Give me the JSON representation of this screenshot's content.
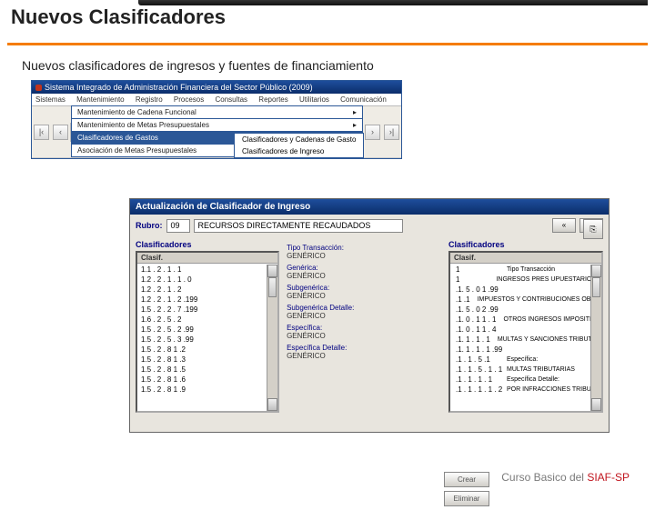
{
  "slide_title": "Nuevos Clasificadores",
  "subtitle": "Nuevos clasificadores de ingresos y fuentes de financiamiento",
  "app": {
    "title": "Sistema Integrado de Administración Financiera del Sector Público (2009)",
    "menu": [
      "Sistemas",
      "Mantenimiento",
      "Registro",
      "Procesos",
      "Consultas",
      "Reportes",
      "Utilitarios",
      "Comunicación"
    ],
    "dropdown": [
      "Mantenimiento de Cadena Funcional",
      "Mantenimiento de Metas Presupuestales",
      "Clasificadores de Gastos",
      "Asociación de Metas Presupuestales"
    ],
    "submenu": [
      "Clasificadores y Cadenas de Gasto",
      "Clasificadores de Ingreso"
    ]
  },
  "dialog": {
    "title": "Actualización de Clasificador de Ingreso",
    "rubro_label": "Rubro:",
    "rubro_code": "09",
    "rubro_desc": "RECURSOS DIRECTAMENTE RECAUDADOS",
    "nav1": "«",
    "nav2": ">",
    "exit": "⎘",
    "left_header": "Clasificadores",
    "left_colhead": "Clasif.",
    "left_items": [
      "1.1 . 2 . 1 . 1",
      "1.2 . 2 . 1 . 1 . 0",
      "1.2 . 2 . 1 . 2",
      "1.2 . 2 . 1 . 2 .199",
      "1.5 . 2 . 2 . 7 .199",
      "1.6 . 2 . 5 . 2",
      "1.5 . 2 . 5 . 2 .99",
      "1.5 . 2 . 5 . 3 .99",
      "1.5 . 2 . 8 1 .2",
      "1.5 . 2 . 8 1 .3",
      "1.5 . 2 . 8 1 .5",
      "1.5 . 2 . 8 1 .6",
      "1.5 . 2 . 8 1 .9"
    ],
    "mid_labels": {
      "tipo": "Tipo Transacción:",
      "tipo_v": "GENÉRICO",
      "gen": "Genérica:",
      "gen_v": "GENÉRICO",
      "sub": "Subgenérica:",
      "sub_v": "GENÉRICO",
      "subd": "Subgenérica Detalle:",
      "subd_v": "GENÉRICO",
      "esp": "Específica:",
      "esp_v": "GENÉRICO",
      "espd": "Específica Detalle:",
      "espd_v": "GENÉRICO"
    },
    "btn_crear": "Crear",
    "btn_elim": "Eliminar",
    "right_header": "Clasificadores",
    "right_colhead": "Clasif.",
    "right_rows": [
      {
        "c": "1",
        "d": "Tipo Transacción"
      },
      {
        "c": "1",
        "d": "INGRESOS PRES UPUESTARIOS"
      },
      {
        "c": ".1. 5 . 0 1 .99",
        "d": ""
      },
      {
        "c": ".1 .1",
        "d": "IMPUESTOS Y CONTRIBUCIONES OBLIGATORIAS"
      },
      {
        "c": ".1. 5 . 0 2 .99",
        "d": ""
      },
      {
        "c": ".1. 0 . 1 1 . 1",
        "d": "OTROS INGRESOS IMPOSITIVOS"
      },
      {
        "c": ".1. 0 . 1 1 . 4",
        "d": ""
      },
      {
        "c": ".1. 1 . 1 . 1",
        "d": "MULTAS Y SANCIONES TRIBUTARIAS"
      },
      {
        "c": ".1. 1 . 1 . 1 .99",
        "d": ""
      },
      {
        "c": ".1 . 1 . 5 .1",
        "d": "Específica:"
      },
      {
        "c": ".1 . 1 . 5 . 1 . 1",
        "d": "MULTAS TRIBUTARIAS"
      },
      {
        "c": ".1 . 1 . 1 . 1",
        "d": "Específica Detalle:"
      },
      {
        "c": ".1 . 1 . 1 . 1 . 2",
        "d": "POR INFRACCIONES TRIBUTARIAS"
      }
    ]
  },
  "footer": {
    "p1": "Curso  Basico del ",
    "p2": "SIAF-SP"
  }
}
